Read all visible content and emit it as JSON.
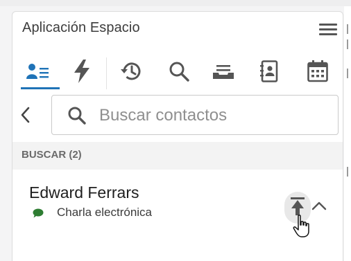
{
  "app": {
    "title": "Aplicación Espacio"
  },
  "toolbar": {
    "items": [
      {
        "name": "contacts",
        "icon": "contacts-list-icon",
        "active": true
      },
      {
        "name": "actions",
        "icon": "lightning-icon",
        "active": false
      },
      {
        "name": "history",
        "icon": "history-icon",
        "active": false
      },
      {
        "name": "search",
        "icon": "search-icon",
        "active": false
      },
      {
        "name": "queue",
        "icon": "inbox-tray-icon",
        "active": false
      },
      {
        "name": "directory",
        "icon": "address-book-icon",
        "active": false
      },
      {
        "name": "calendar",
        "icon": "calendar-icon",
        "active": false
      }
    ]
  },
  "search": {
    "placeholder": "Buscar contactos",
    "value": ""
  },
  "results": {
    "header": "BUSCAR (2)",
    "contacts": [
      {
        "name": "Edward Ferrars",
        "channel": "Charla electrónica",
        "channel_color": "#2e7d32"
      }
    ]
  },
  "colors": {
    "accent": "#1f73b7",
    "icon": "#555555",
    "chat": "#2e7d32"
  }
}
